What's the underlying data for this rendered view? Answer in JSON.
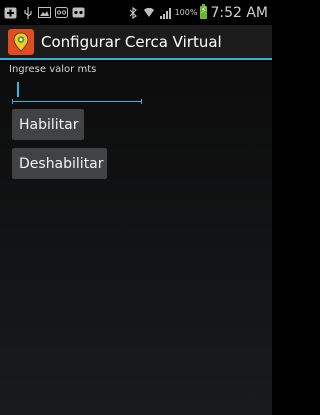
{
  "status_bar": {
    "icons": [
      "add-icon",
      "usb-icon",
      "image-icon",
      "voicemail-icon",
      "cassette-icon",
      "bluetooth-icon",
      "wifi-icon",
      "signal-icon"
    ],
    "battery_percent": "100%",
    "time": "7:52 AM"
  },
  "action_bar": {
    "title": "Configurar Cerca Virtual",
    "icon": "map-pin-icon",
    "accent_color": "#2FB4E0"
  },
  "form": {
    "label": "Ingrese valor mts",
    "input_value": "",
    "enable_button": "Habilitar",
    "disable_button": "Deshabilitar"
  },
  "colors": {
    "background": "#000000",
    "button_bg": "#404244",
    "input_accent": "#33B5E5",
    "app_icon_bg": "#E24D1F"
  }
}
